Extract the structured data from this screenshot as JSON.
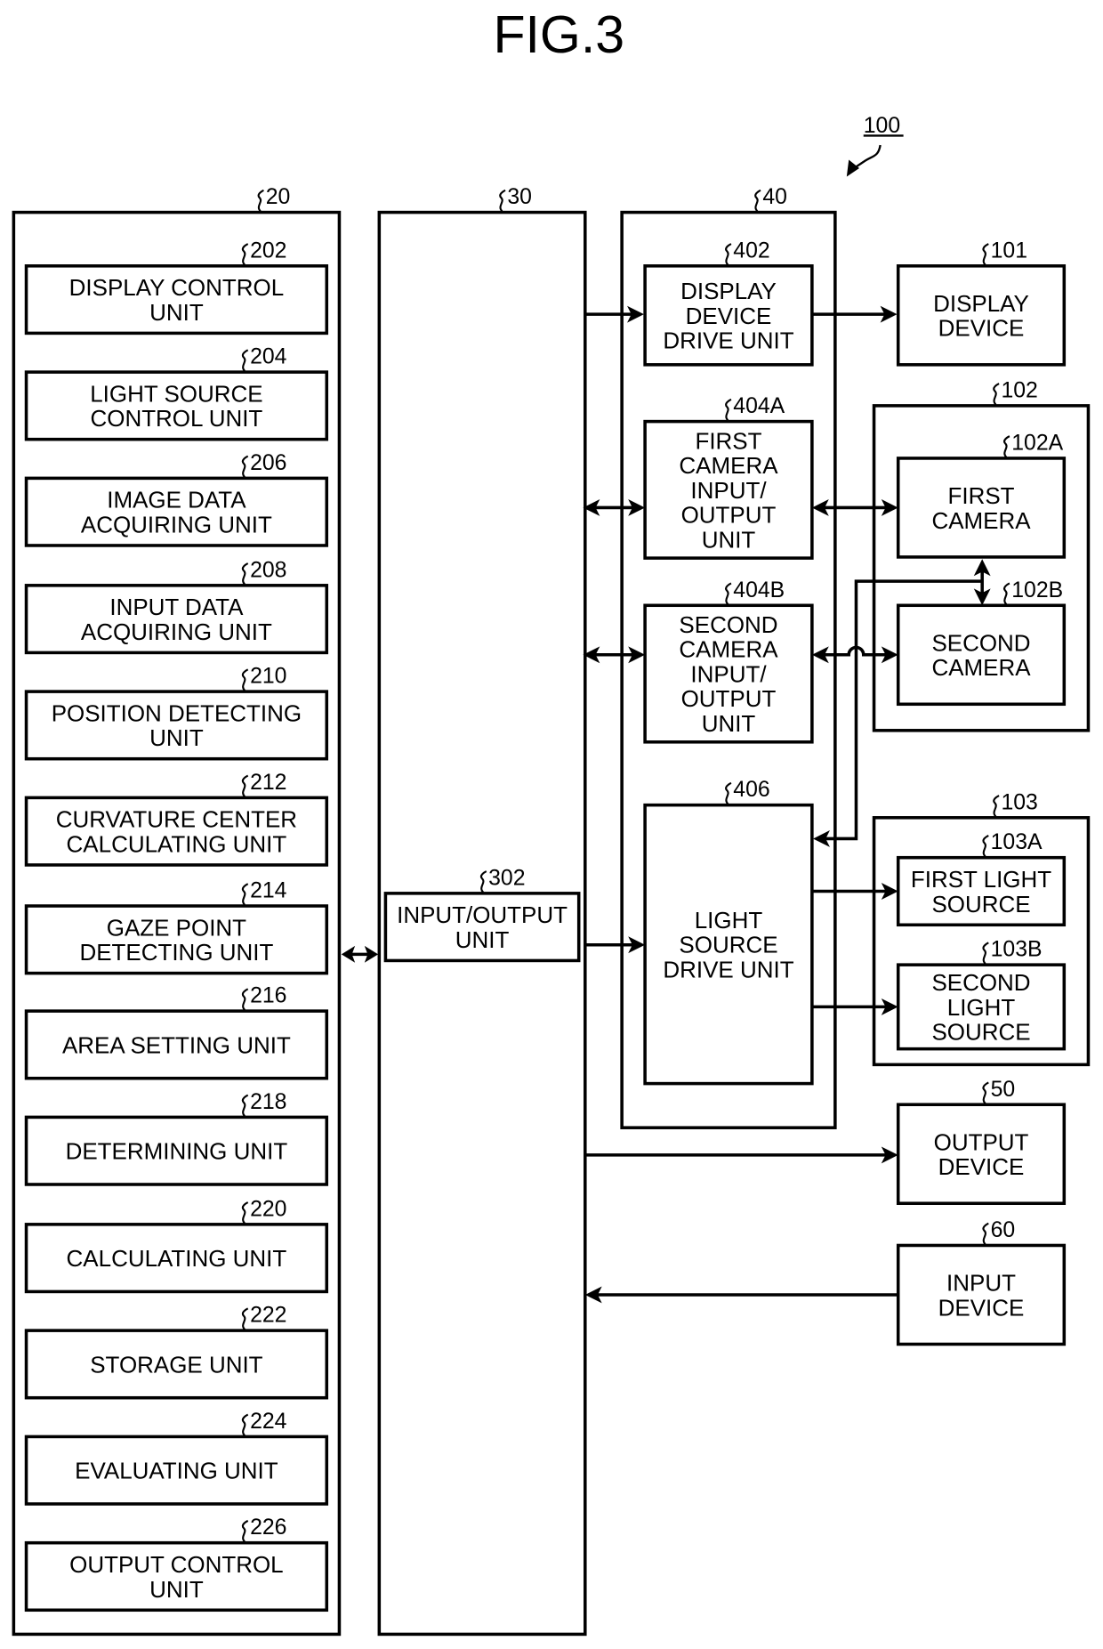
{
  "figure": {
    "title": "FIG.3",
    "system_ref": "100"
  },
  "blocks": {
    "computer": {
      "ref": "20"
    },
    "io_controller": {
      "ref": "30"
    },
    "drive_circuit": {
      "ref": "40"
    },
    "u202": {
      "ref": "202",
      "lines": [
        "DISPLAY CONTROL",
        "UNIT"
      ]
    },
    "u204": {
      "ref": "204",
      "lines": [
        "LIGHT SOURCE",
        "CONTROL UNIT"
      ]
    },
    "u206": {
      "ref": "206",
      "lines": [
        "IMAGE DATA",
        "ACQUIRING UNIT"
      ]
    },
    "u208": {
      "ref": "208",
      "lines": [
        "INPUT DATA",
        "ACQUIRING UNIT"
      ]
    },
    "u210": {
      "ref": "210",
      "lines": [
        "POSITION DETECTING",
        "UNIT"
      ]
    },
    "u212": {
      "ref": "212",
      "lines": [
        "CURVATURE CENTER",
        "CALCULATING UNIT"
      ]
    },
    "u214": {
      "ref": "214",
      "lines": [
        "GAZE POINT",
        "DETECTING UNIT"
      ]
    },
    "u216": {
      "ref": "216",
      "lines": [
        "AREA SETTING UNIT"
      ]
    },
    "u218": {
      "ref": "218",
      "lines": [
        "DETERMINING UNIT"
      ]
    },
    "u220": {
      "ref": "220",
      "lines": [
        "CALCULATING UNIT"
      ]
    },
    "u222": {
      "ref": "222",
      "lines": [
        "STORAGE UNIT"
      ]
    },
    "u224": {
      "ref": "224",
      "lines": [
        "EVALUATING UNIT"
      ]
    },
    "u226": {
      "ref": "226",
      "lines": [
        "OUTPUT CONTROL",
        "UNIT"
      ]
    },
    "u302": {
      "ref": "302",
      "lines": [
        "INPUT/OUTPUT",
        "UNIT"
      ]
    },
    "u402": {
      "ref": "402",
      "lines": [
        "DISPLAY",
        "DEVICE",
        "DRIVE UNIT"
      ]
    },
    "u404a": {
      "ref": "404A",
      "lines": [
        "FIRST",
        "CAMERA",
        "INPUT/",
        "OUTPUT",
        "UNIT"
      ]
    },
    "u404b": {
      "ref": "404B",
      "lines": [
        "SECOND",
        "CAMERA",
        "INPUT/",
        "OUTPUT",
        "UNIT"
      ]
    },
    "u406": {
      "ref": "406",
      "lines": [
        "LIGHT",
        "SOURCE",
        "DRIVE UNIT"
      ]
    },
    "d101": {
      "ref": "101",
      "lines": [
        "DISPLAY",
        "DEVICE"
      ]
    },
    "g102": {
      "ref": "102"
    },
    "d102a": {
      "ref": "102A",
      "lines": [
        "FIRST",
        "CAMERA"
      ]
    },
    "d102b": {
      "ref": "102B",
      "lines": [
        "SECOND",
        "CAMERA"
      ]
    },
    "g103": {
      "ref": "103"
    },
    "d103a": {
      "ref": "103A",
      "lines": [
        "FIRST LIGHT",
        "SOURCE"
      ]
    },
    "d103b": {
      "ref": "103B",
      "lines": [
        "SECOND",
        "LIGHT",
        "SOURCE"
      ]
    },
    "d50": {
      "ref": "50",
      "lines": [
        "OUTPUT",
        "DEVICE"
      ]
    },
    "d60": {
      "ref": "60",
      "lines": [
        "INPUT",
        "DEVICE"
      ]
    }
  }
}
